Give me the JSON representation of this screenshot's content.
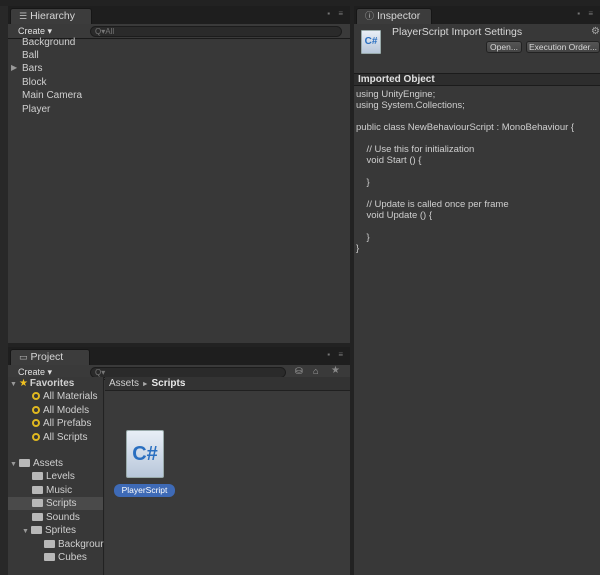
{
  "hierarchy": {
    "tab": "Hierarchy",
    "create": "Create",
    "search_placeholder": "Q▾All",
    "items": [
      "Background",
      "Ball",
      "Bars",
      "Block",
      "Main Camera",
      "Player"
    ]
  },
  "inspector": {
    "tab": "Inspector",
    "title": "PlayerScript Import Settings",
    "icon_text": "C#",
    "open_button": "Open...",
    "execution_order_button": "Execution Order...",
    "section": "Imported Object",
    "code": [
      "using UnityEngine;",
      "using System.Collections;",
      "",
      "public class NewBehaviourScript : MonoBehaviour {",
      "",
      "    // Use this for initialization",
      "    void Start () {",
      "",
      "    }",
      "",
      "    // Update is called once per frame",
      "    void Update () {",
      "",
      "    }",
      "}"
    ]
  },
  "project": {
    "tab": "Project",
    "create": "Create",
    "favorites_label": "Favorites",
    "favorites": [
      "All Materials",
      "All Models",
      "All Prefabs",
      "All Scripts"
    ],
    "assets_label": "Assets",
    "folders": [
      "Levels",
      "Music",
      "Scripts",
      "Sounds",
      "Sprites"
    ],
    "sprites_children": [
      "Backgrour",
      "Cubes"
    ],
    "breadcrumb_root": "Assets",
    "breadcrumb_sep": "►",
    "breadcrumb_current": "Scripts",
    "file_name": "PlayerScript",
    "file_icon_text": "C#"
  },
  "colors": {
    "selection": "#3e6ab6",
    "favorite_star": "#f0c020"
  }
}
